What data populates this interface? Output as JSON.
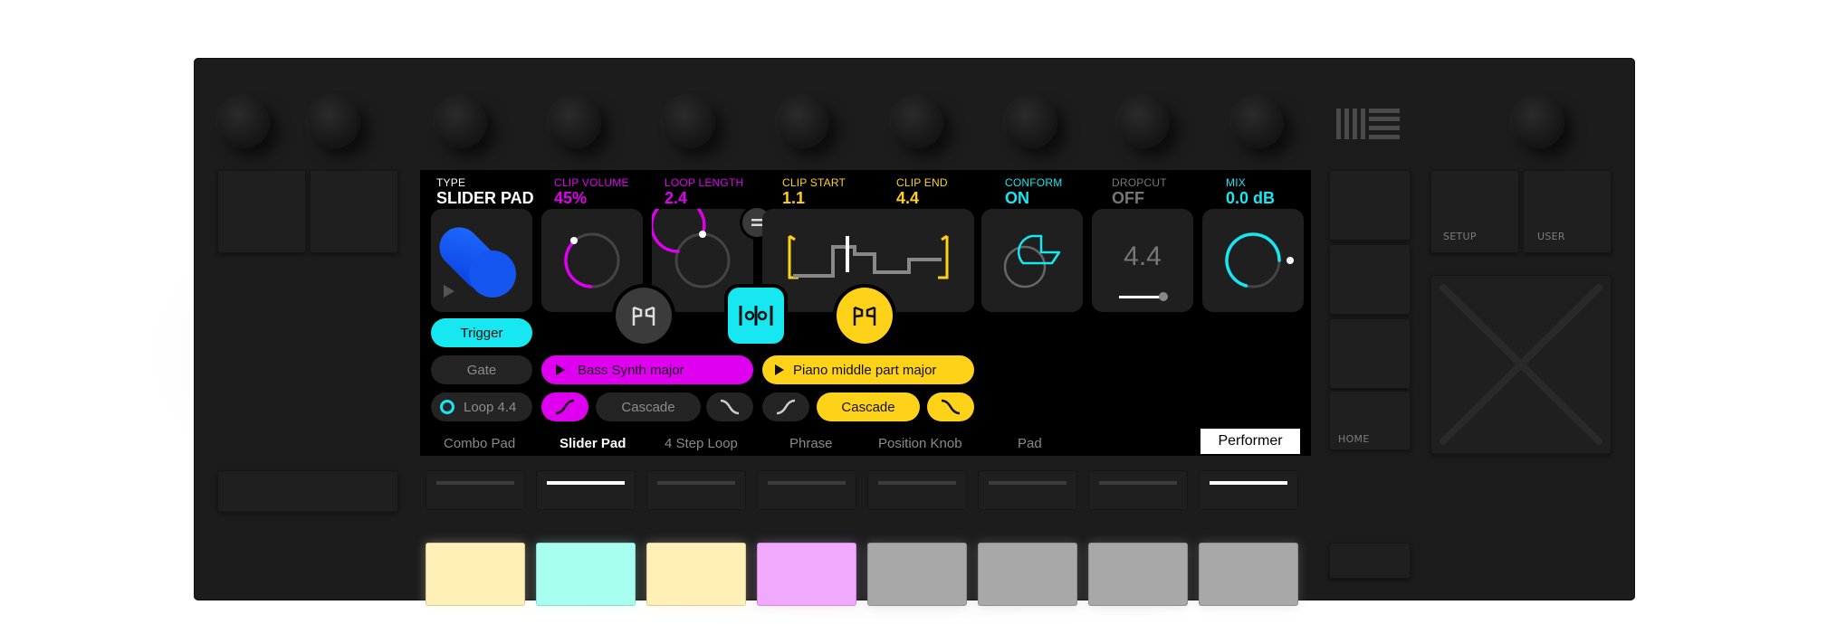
{
  "header": {
    "type": {
      "key": "TYPE",
      "value": "SLIDER PAD",
      "color": "#ffffff"
    },
    "clip_volume": {
      "key": "CLIP VOLUME",
      "value": "45%",
      "color": "#e000f0"
    },
    "loop_length": {
      "key": "LOOP LENGTH",
      "value": "2.4",
      "color": "#e000f0"
    },
    "clip_start": {
      "key": "CLIP START",
      "value": "1.1",
      "color": "#ffd21a"
    },
    "clip_end": {
      "key": "CLIP END",
      "value": "4.4",
      "color": "#ffd21a"
    },
    "conform": {
      "key": "CONFORM",
      "value": "ON",
      "color": "#16e7f0"
    },
    "dropcut": {
      "key": "DROPCUT",
      "value": "OFF",
      "color": "#777777"
    },
    "mix": {
      "key": "MIX",
      "value": "0.0 dB",
      "color": "#16e7f0"
    }
  },
  "tiles": {
    "dropcut_value": "4.4",
    "clip_volume_level": 0.45,
    "mix_level": 0.85
  },
  "left_buttons": {
    "trigger": "Trigger",
    "gate": "Gate",
    "loop": "Loop 4.4"
  },
  "clips": {
    "magenta": {
      "label": "Bass Synth major",
      "cascade": "Cascade"
    },
    "yellow": {
      "label": "Piano middle part major",
      "cascade": "Cascade"
    }
  },
  "tabs": [
    {
      "label": "Combo Pad",
      "active": false
    },
    {
      "label": "Slider Pad",
      "active": true
    },
    {
      "label": "4 Step Loop",
      "active": false
    },
    {
      "label": "Phrase",
      "active": false
    },
    {
      "label": "Position Knob",
      "active": false
    },
    {
      "label": "Pad",
      "active": false
    }
  ],
  "performer_tab": "Performer",
  "side_labels": {
    "setup": "SETUP",
    "user": "USER",
    "home": "HOME"
  },
  "colors": {
    "magenta": "#e000f0",
    "yellow": "#ffd21a",
    "cyan": "#16e7f0",
    "blue": "#1f5fff"
  },
  "strip_lit": [
    false,
    true,
    false,
    false,
    false,
    false,
    false,
    true
  ],
  "pad_colors": [
    "#fff0b8",
    "#a9ffef",
    "#fff0b8",
    "#f0a9fc",
    "#a8a8a8",
    "#a8a8a8",
    "#a8a8a8",
    "#a8a8a8"
  ]
}
